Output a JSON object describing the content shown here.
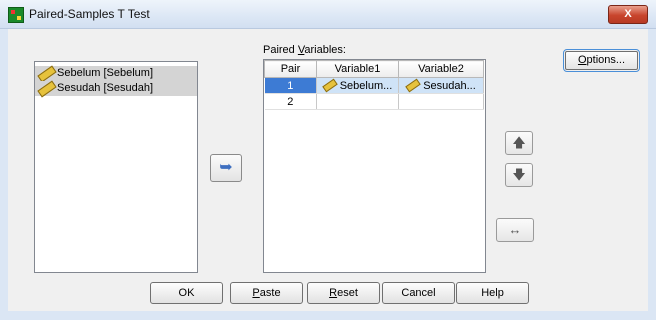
{
  "window": {
    "title": "Paired-Samples T Test",
    "close_label": "X"
  },
  "source_variables": [
    {
      "label": "Sebelum [Sebelum]",
      "icon": "scale-ruler-icon"
    },
    {
      "label": "Sesudah [Sesudah]",
      "icon": "scale-ruler-icon"
    }
  ],
  "move_button": {
    "icon": "arrow-right-icon",
    "glyph": "➥"
  },
  "paired": {
    "label_pre": "Paired ",
    "label_mnemonic": "V",
    "label_post": "ariables:",
    "columns": [
      "Pair",
      "Variable1",
      "Variable2"
    ],
    "rows": [
      {
        "pair": "1",
        "var1": "Sebelum...",
        "var2": "Sesudah..."
      },
      {
        "pair": "2",
        "var1": "",
        "var2": ""
      }
    ]
  },
  "reorder": {
    "up_glyph": "🡅",
    "down_glyph": "🡇",
    "swap_glyph": "↔"
  },
  "buttons": {
    "options_mnemonic": "O",
    "options_rest": "ptions...",
    "ok": "OK",
    "paste_mnemonic": "P",
    "paste_rest": "aste",
    "reset_mnemonic": "R",
    "reset_rest": "eset",
    "cancel": "Cancel",
    "help": "Help"
  }
}
